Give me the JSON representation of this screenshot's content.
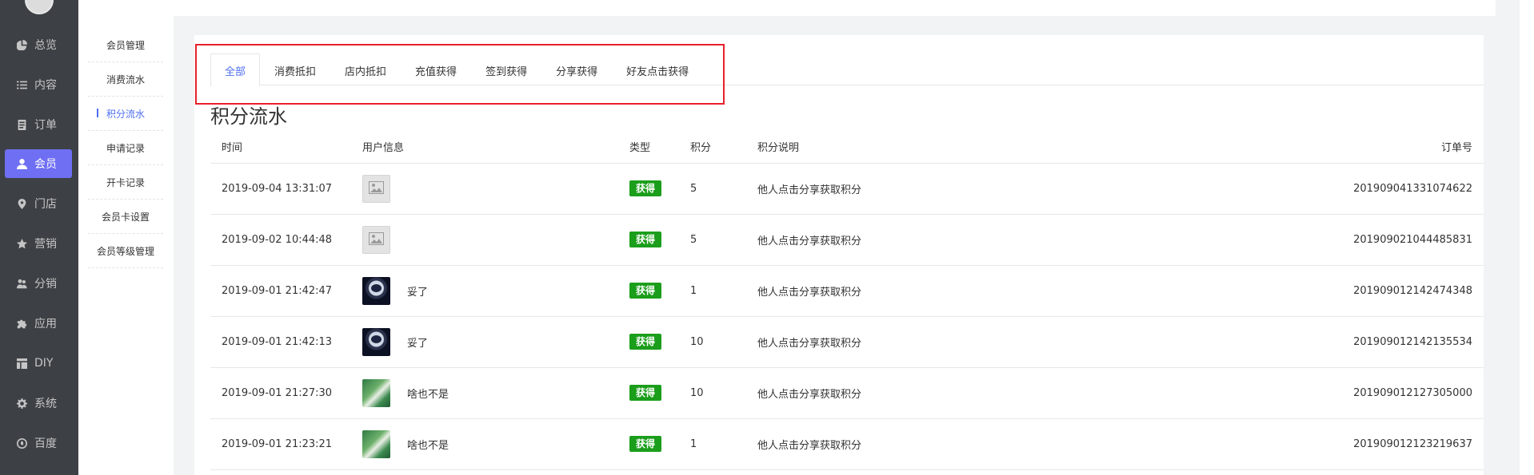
{
  "sidebar": {
    "items": [
      {
        "label": "总览",
        "icon": "pie-chart-icon"
      },
      {
        "label": "内容",
        "icon": "list-icon"
      },
      {
        "label": "订单",
        "icon": "document-icon"
      },
      {
        "label": "会员",
        "icon": "user-icon",
        "active": true
      },
      {
        "label": "门店",
        "icon": "location-pin-icon"
      },
      {
        "label": "营销",
        "icon": "star-icon"
      },
      {
        "label": "分销",
        "icon": "users-icon"
      },
      {
        "label": "应用",
        "icon": "puzzle-icon"
      },
      {
        "label": "DIY",
        "icon": "layout-icon"
      },
      {
        "label": "系统",
        "icon": "gear-icon"
      },
      {
        "label": "百度",
        "icon": "baidu-icon"
      }
    ]
  },
  "subsidebar": {
    "items": [
      {
        "label": "会员管理"
      },
      {
        "label": "消费流水"
      },
      {
        "label": "积分流水",
        "active": true
      },
      {
        "label": "申请记录"
      },
      {
        "label": "开卡记录"
      },
      {
        "label": "会员卡设置"
      },
      {
        "label": "会员等级管理"
      }
    ]
  },
  "tabs": [
    {
      "label": "全部",
      "active": true
    },
    {
      "label": "消费抵扣"
    },
    {
      "label": "店内抵扣"
    },
    {
      "label": "充值获得"
    },
    {
      "label": "签到获得"
    },
    {
      "label": "分享获得"
    },
    {
      "label": "好友点击获得"
    }
  ],
  "section_title": "积分流水",
  "table": {
    "headers": {
      "time": "时间",
      "user": "用户信息",
      "type": "类型",
      "points": "积分",
      "description": "积分说明",
      "order_no": "订单号"
    },
    "rows": [
      {
        "time": "2019-09-04 13:31:07",
        "avatar": "placeholder",
        "nickname": "",
        "type": "获得",
        "points": "5",
        "description": "他人点击分享获取积分",
        "order_no": "201909041331074622"
      },
      {
        "time": "2019-09-02 10:44:48",
        "avatar": "placeholder",
        "nickname": "",
        "type": "获得",
        "points": "5",
        "description": "他人点击分享获取积分",
        "order_no": "201909021044485831"
      },
      {
        "time": "2019-09-01 21:42:47",
        "avatar": "astronaut",
        "nickname": "妥了",
        "type": "获得",
        "points": "1",
        "description": "他人点击分享获取积分",
        "order_no": "201909012142474348"
      },
      {
        "time": "2019-09-01 21:42:13",
        "avatar": "astronaut",
        "nickname": "妥了",
        "type": "获得",
        "points": "10",
        "description": "他人点击分享获取积分",
        "order_no": "201909012142135534"
      },
      {
        "time": "2019-09-01 21:27:30",
        "avatar": "nature",
        "nickname": "啥也不是",
        "type": "获得",
        "points": "10",
        "description": "他人点击分享获取积分",
        "order_no": "201909012127305000"
      },
      {
        "time": "2019-09-01 21:23:21",
        "avatar": "nature",
        "nickname": "啥也不是",
        "type": "获得",
        "points": "1",
        "description": "他人点击分享获取积分",
        "order_no": "201909012123219637"
      }
    ]
  },
  "colors": {
    "sidebar_bg": "#3d4145",
    "active_nav": "#6f6ff4",
    "accent_blue": "#4e6ef2",
    "badge_green": "#1b9e1b",
    "highlight_red": "#e8202a"
  }
}
